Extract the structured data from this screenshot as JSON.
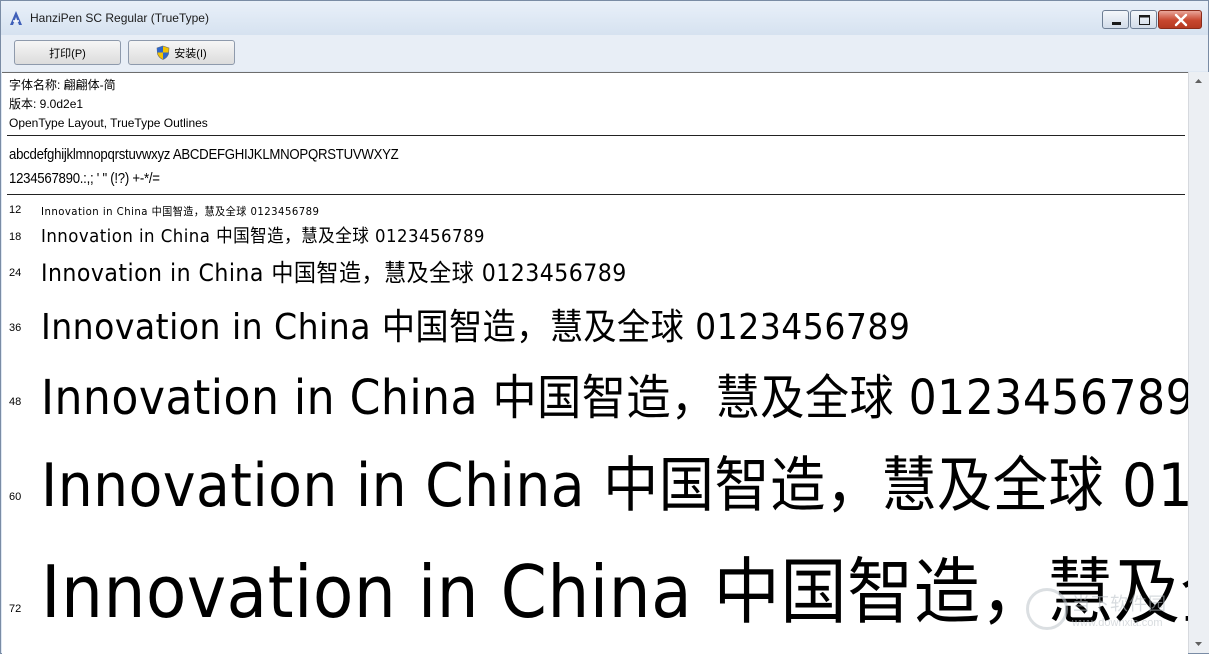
{
  "window": {
    "title": "HanziPen SC Regular (TrueType)"
  },
  "toolbar": {
    "print_label": "打印(P)",
    "install_label": "安装(I)"
  },
  "font_info": {
    "name_line": "字体名称: 翩翩体-简",
    "version_line": "版本: 9.0d2e1",
    "type_line": "OpenType Layout, TrueType Outlines"
  },
  "charset": {
    "line1": "abcdefghijklmnopqrstuvwxyz ABCDEFGHIJKLMNOPQRSTUVWXYZ",
    "line2": "1234567890.:,; ' \" (!?) +-*/="
  },
  "samples": {
    "text": "Innovation in China 中国智造，慧及全球 0123456789",
    "sizes": [
      "12",
      "18",
      "24",
      "36",
      "48",
      "60",
      "72"
    ]
  },
  "watermark": {
    "brand": "当下软件园",
    "url": "www.downxia.com"
  },
  "icons": {
    "app": "font-app-icon",
    "shield": "uac-shield-icon",
    "minimize": "minimize-icon",
    "maximize": "maximize-icon",
    "close": "close-icon"
  },
  "colors": {
    "close_button": "#c8472f",
    "titlebar": "#dfe8f3"
  }
}
